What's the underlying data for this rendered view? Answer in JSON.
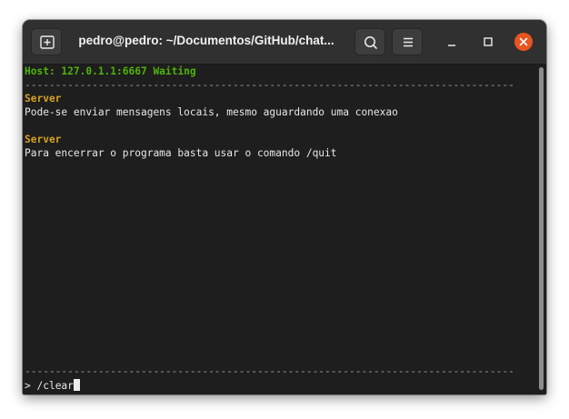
{
  "window": {
    "title": "pedro@pedro: ~/Documentos/GitHub/chat..."
  },
  "titlebar": {
    "new_tab_icon": "new-tab-icon",
    "search_icon": "search-icon",
    "menu_icon": "hamburger-menu-icon",
    "minimize_icon": "minimize-icon",
    "maximize_icon": "maximize-icon",
    "close_icon": "close-icon",
    "close_color": "#e95420"
  },
  "terminal": {
    "host_line": "Host: 127.0.1.1:6667 Waiting",
    "separator": "--------------------------------------------------------------------------------",
    "messages": [
      {
        "sender": "Server",
        "text": "Pode-se enviar mensagens locais, mesmo aguardando uma conexao"
      },
      {
        "sender": "Server",
        "text": "Para encerrar o programa basta usar o comando /quit"
      }
    ],
    "input_separator": "--------------------------------------------------------------------------------",
    "prompt": "> ",
    "input_value": "/clear"
  },
  "colors": {
    "host": "#4fb30b",
    "sender": "#d6a123",
    "background": "#1e1e1e",
    "titlebar": "#303030"
  }
}
